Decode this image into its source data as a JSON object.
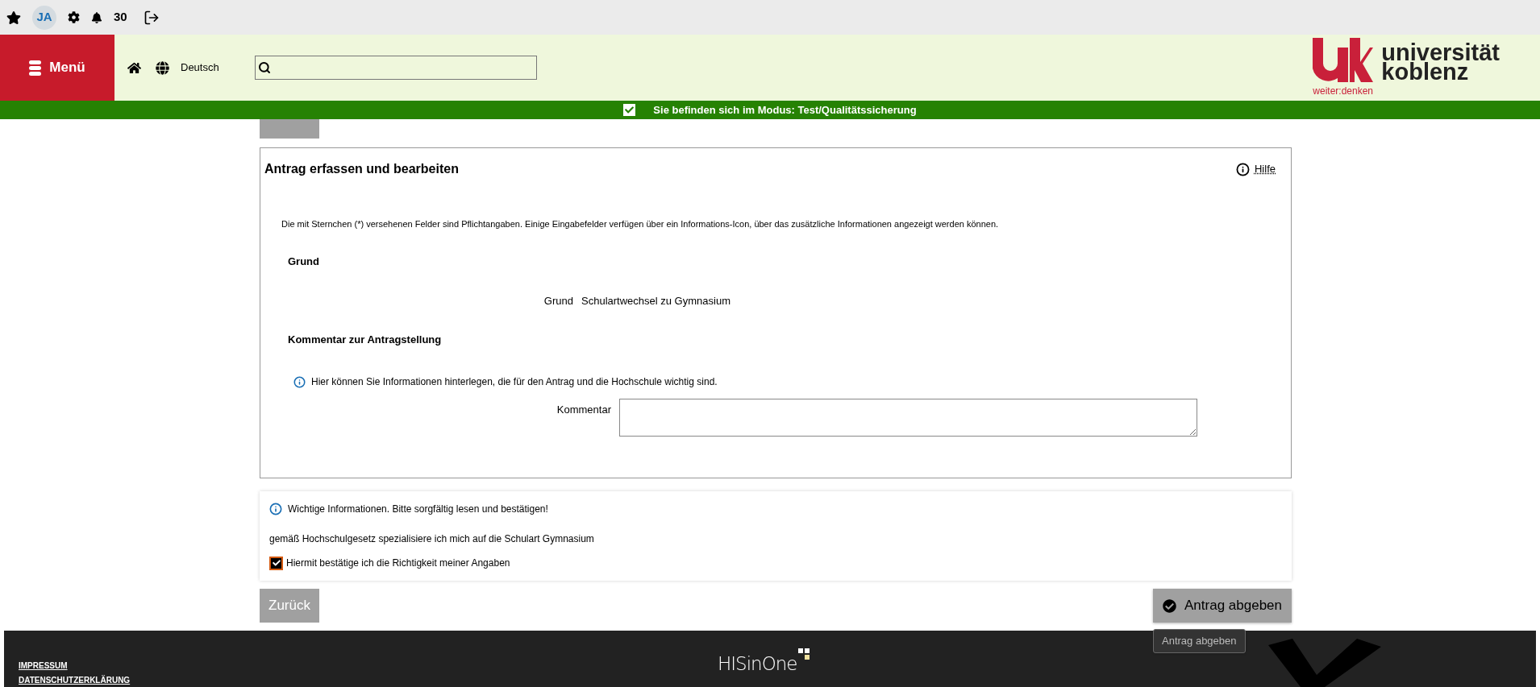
{
  "toolbar": {
    "user_initials": "JA",
    "notification_count": "30"
  },
  "header": {
    "menu_label": "Menü",
    "language": "Deutsch"
  },
  "logo": {
    "line1": "universität",
    "line2": "koblenz",
    "tagline": "weiter:denken"
  },
  "mode_banner": {
    "text": "Sie befinden sich im Modus: Test/Qualitätssicherung"
  },
  "form": {
    "title": "Antrag erfassen und bearbeiten",
    "help": "Hilfe",
    "note": "Die mit Sternchen (*) versehenen Felder sind Pflichtangaben. Einige Eingabefelder verfügen über ein Informations-Icon, über das zusätzliche Informationen angezeigt werden können.",
    "sections": [
      {
        "heading": "Grund",
        "fields": [
          {
            "kind": "value",
            "label": "Grund",
            "value": "Schulartwechsel zu Gymnasium"
          }
        ]
      },
      {
        "heading": "Kommentar zur Antragstellung",
        "info": "Hier können Sie Informationen hinterlegen, die für den Antrag und die Hochschule wichtig sind.",
        "fields": [
          {
            "kind": "textarea",
            "label": "Kommentar"
          }
        ]
      }
    ]
  },
  "confirmation": {
    "info": "Wichtige Informationen. Bitte sorgfältig lesen und bestätigen!",
    "statement": "gemäß Hochschulgesetz spezialisiere ich mich auf die Schulart Gymnasium",
    "checkbox": {
      "label": "Hiermit bestätige ich die Richtigkeit meiner Angaben",
      "checked": true
    }
  },
  "actions": {
    "back": "Zurück",
    "submit": "Antrag abgeben",
    "tooltip": "Antrag abgeben"
  },
  "footer": {
    "links": [
      "IMPRESSUM",
      "DATENSCHUTZERKLÄRUNG"
    ],
    "brand": "HISinOne"
  }
}
